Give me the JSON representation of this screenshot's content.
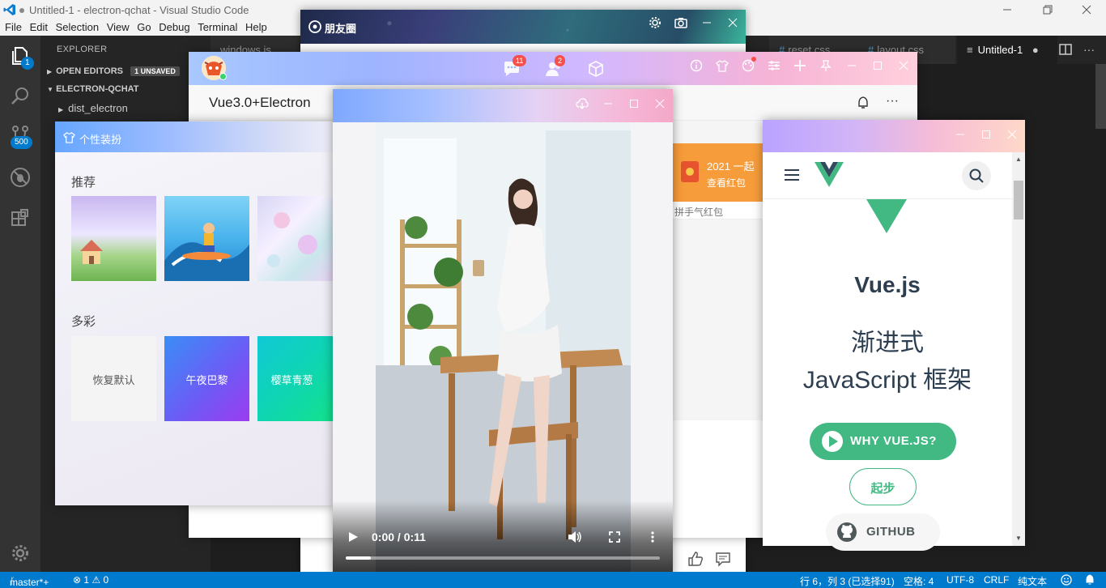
{
  "vscode": {
    "window_title": "Untitled-1 - electron-qchat - Visual Studio Code",
    "menu": [
      "File",
      "Edit",
      "Selection",
      "View",
      "Go",
      "Debug",
      "Terminal",
      "Help"
    ],
    "explorer_label": "EXPLORER",
    "open_editors_label": "OPEN EDITORS",
    "unsaved_label": "1 UNSAVED",
    "project_label": "ELECTRON-QCHAT",
    "tree_item": "dist_electron",
    "tabs": {
      "t1": "windows.js",
      "t2": "reset.css",
      "t3": "layout.css",
      "active": "Untitled-1"
    },
    "badges": {
      "explorer": "1",
      "scm": "500"
    },
    "status": {
      "branch": "master*+",
      "problems": "⊗ 1 ⚠ 0",
      "cursor": "行 6，列 3 (已选择91)",
      "spaces": "空格: 4",
      "encoding": "UTF-8",
      "eol": "CRLF",
      "language": "纯文本"
    }
  },
  "moments": {
    "title": "朋友圈"
  },
  "chat": {
    "subtitle": "Vue3.0+Electron",
    "badge_messages": "11",
    "badge_contacts": "2",
    "redpack_title": "2021 一起",
    "redpack_action": "查看红包",
    "redpack_sub": "拼手气红包"
  },
  "theme": {
    "title": "个性装扮",
    "section_recommend": "推荐",
    "section_colorful": "多彩",
    "colors": [
      "恢复默认",
      "午夜巴黎",
      "樱草青葱"
    ]
  },
  "video": {
    "time": "0:00 / 0:11",
    "progress": 0.08
  },
  "vue": {
    "brand": "Vue.js",
    "tagline1": "渐进式",
    "tagline2": "JavaScript 框架",
    "btn_why": "WHY VUE.JS?",
    "btn_start": "起步",
    "btn_github": "GITHUB",
    "accent": "#42b983"
  }
}
